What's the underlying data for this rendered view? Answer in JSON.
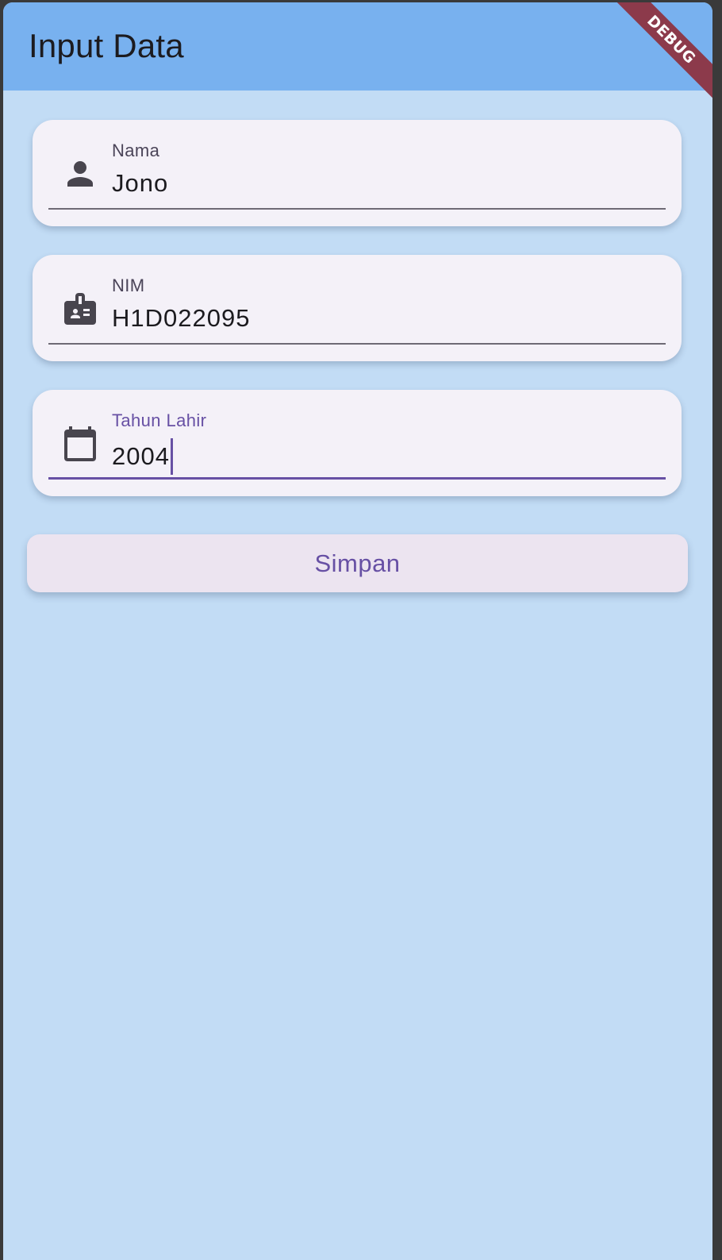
{
  "appbar": {
    "title": "Input Data",
    "debug_banner": "DEBUG"
  },
  "form": {
    "fields": [
      {
        "label": "Nama",
        "value": "Jono",
        "icon": "person-icon",
        "focused": false
      },
      {
        "label": "NIM",
        "value": "H1D022095",
        "icon": "badge-icon",
        "focused": false
      },
      {
        "label": "Tahun Lahir",
        "value": "2004",
        "icon": "calendar-icon",
        "focused": true
      }
    ],
    "save_label": "Simpan"
  },
  "colors": {
    "background": "#c2dcf5",
    "appbar": "#78b1ef",
    "field_background": "#f4f1f8",
    "accent": "#6750a4",
    "button_background": "#ece4f0",
    "debug_ribbon": "#8c3a4b"
  }
}
